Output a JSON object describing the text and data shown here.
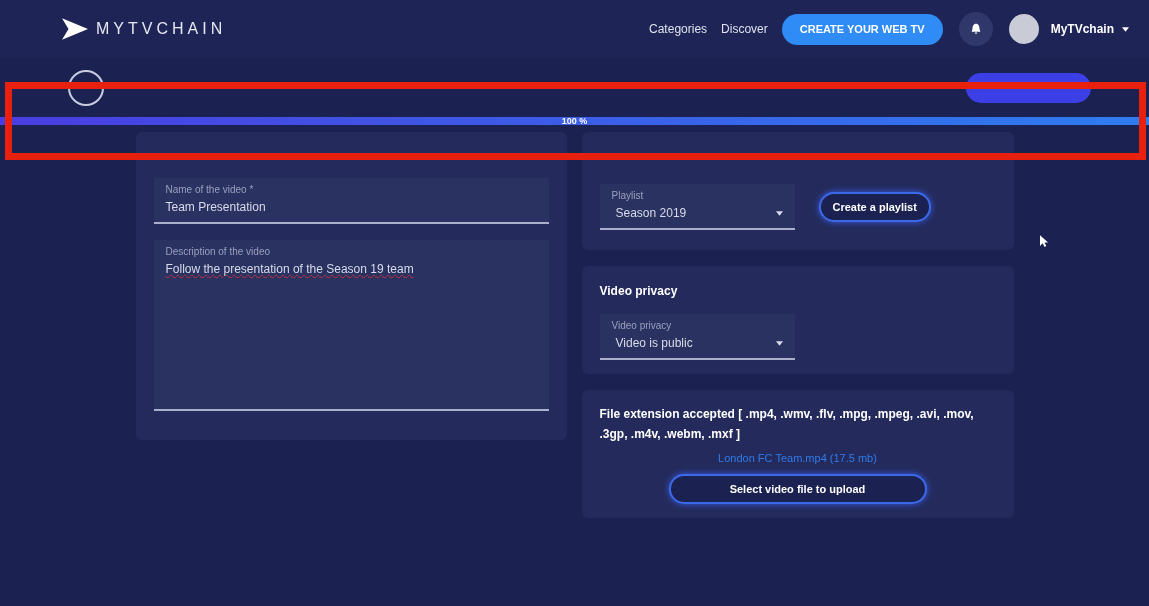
{
  "header": {
    "brand": "MYTVCHAIN",
    "nav": [
      "Categories",
      "Discover"
    ],
    "cta": "CREATE YOUR WEB TV",
    "user": "MyTVchain"
  },
  "upload": {
    "level": 1,
    "label": "100 %"
  },
  "video_info": {
    "name": {
      "label": "Name of the video *",
      "value": "Team Presentation"
    },
    "description": {
      "label": "Description of the video",
      "value": "Follow the presentation of the Season 19 team"
    }
  },
  "playlist": {
    "label": "Playlist",
    "value": "Season 2019",
    "button": "Create a playlist"
  },
  "privacy": {
    "title": "Video privacy",
    "label": "Video privacy",
    "value": "Video is public"
  },
  "file": {
    "extensions": "File extension accepted [ .mp4, .wmv, .flv, .mpg, .mpeg, .avi, .mov, .3gp, .m4v, .webm, .mxf ]",
    "filename": "London FC Team.mp4 (17.5 mb)",
    "button": "Select video file to upload"
  }
}
